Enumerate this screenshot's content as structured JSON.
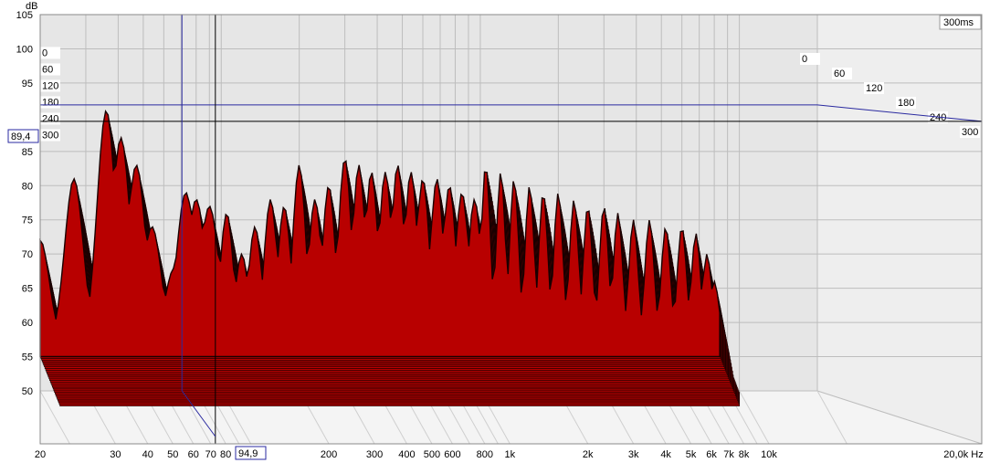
{
  "chart_data": {
    "type": "waterfall",
    "units": {
      "y": "dB",
      "x": "Hz"
    },
    "corner_label": "300ms",
    "ylim": [
      50,
      105
    ],
    "y_ticks": [
      {
        "v": 105,
        "label": "105"
      },
      {
        "v": 100,
        "label": "100"
      },
      {
        "v": 95,
        "label": "95"
      },
      {
        "v": 85,
        "label": "85"
      },
      {
        "v": 80,
        "label": "80"
      },
      {
        "v": 75,
        "label": "75"
      },
      {
        "v": 70,
        "label": "70"
      },
      {
        "v": 65,
        "label": "65"
      },
      {
        "v": 60,
        "label": "60"
      },
      {
        "v": 55,
        "label": "55"
      },
      {
        "v": 50,
        "label": "50"
      }
    ],
    "xlim": [
      20,
      20000
    ],
    "x_ticks": [
      {
        "v": 20,
        "label": "20"
      },
      {
        "v": 30,
        "label": "30"
      },
      {
        "v": 40,
        "label": "40"
      },
      {
        "v": 50,
        "label": "50"
      },
      {
        "v": 60,
        "label": "60"
      },
      {
        "v": 70,
        "label": "70"
      },
      {
        "v": 80,
        "label": "80"
      },
      {
        "v": 200,
        "label": "200"
      },
      {
        "v": 300,
        "label": "300"
      },
      {
        "v": 400,
        "label": "400"
      },
      {
        "v": 500,
        "label": "500"
      },
      {
        "v": 600,
        "label": "600"
      },
      {
        "v": 800,
        "label": "800"
      },
      {
        "v": 1000,
        "label": "1k"
      },
      {
        "v": 2000,
        "label": "2k"
      },
      {
        "v": 3000,
        "label": "3k"
      },
      {
        "v": 4000,
        "label": "4k"
      },
      {
        "v": 5000,
        "label": "5k"
      },
      {
        "v": 6000,
        "label": "6k"
      },
      {
        "v": 7000,
        "label": "7k"
      },
      {
        "v": 8000,
        "label": "8k"
      },
      {
        "v": 10000,
        "label": "10k"
      },
      {
        "v": 20000,
        "label": "20,0k Hz"
      }
    ],
    "time_slices_ms": [
      "0",
      "60",
      "120",
      "180",
      "240",
      "300"
    ],
    "cursor": {
      "freq_hz": 94.9,
      "freq_label": "94,9",
      "level_db": 89.4,
      "level_label": "89,4"
    },
    "peaks": [
      {
        "f": 20,
        "db": 72
      },
      {
        "f": 27,
        "db": 81
      },
      {
        "f": 36,
        "db": 91
      },
      {
        "f": 41,
        "db": 87
      },
      {
        "f": 47,
        "db": 83
      },
      {
        "f": 54,
        "db": 74
      },
      {
        "f": 60,
        "db": 63
      },
      {
        "f": 66,
        "db": 68
      },
      {
        "f": 73,
        "db": 79
      },
      {
        "f": 80,
        "db": 78
      },
      {
        "f": 90,
        "db": 77
      },
      {
        "f": 105,
        "db": 76
      },
      {
        "f": 120,
        "db": 70
      },
      {
        "f": 135,
        "db": 74
      },
      {
        "f": 155,
        "db": 78
      },
      {
        "f": 175,
        "db": 77
      },
      {
        "f": 200,
        "db": 83
      },
      {
        "f": 230,
        "db": 78
      },
      {
        "f": 260,
        "db": 80
      },
      {
        "f": 300,
        "db": 84
      },
      {
        "f": 340,
        "db": 83
      },
      {
        "f": 380,
        "db": 82
      },
      {
        "f": 430,
        "db": 82
      },
      {
        "f": 480,
        "db": 83
      },
      {
        "f": 540,
        "db": 82
      },
      {
        "f": 600,
        "db": 81
      },
      {
        "f": 680,
        "db": 81
      },
      {
        "f": 760,
        "db": 80
      },
      {
        "f": 850,
        "db": 79
      },
      {
        "f": 950,
        "db": 78
      },
      {
        "f": 1050,
        "db": 83
      },
      {
        "f": 1200,
        "db": 82
      },
      {
        "f": 1350,
        "db": 81
      },
      {
        "f": 1550,
        "db": 80
      },
      {
        "f": 1750,
        "db": 79
      },
      {
        "f": 2000,
        "db": 79
      },
      {
        "f": 2300,
        "db": 78
      },
      {
        "f": 2600,
        "db": 77
      },
      {
        "f": 3000,
        "db": 77
      },
      {
        "f": 3400,
        "db": 76
      },
      {
        "f": 3900,
        "db": 75
      },
      {
        "f": 4500,
        "db": 75
      },
      {
        "f": 5200,
        "db": 74
      },
      {
        "f": 6000,
        "db": 74
      },
      {
        "f": 6800,
        "db": 73
      },
      {
        "f": 7500,
        "db": 70
      },
      {
        "f": 8000,
        "db": 66
      },
      {
        "f": 8300,
        "db": 60
      }
    ],
    "noise_floor_db": 57
  },
  "colors": {
    "fill": "#b80000",
    "stroke": "#1a0000",
    "grid": "#bdbdbd",
    "cursor": "#000000",
    "ref_line": "#2a2aa0",
    "floor_bg": "#f4f4f4",
    "wall_bg": "#e6e6e6"
  }
}
